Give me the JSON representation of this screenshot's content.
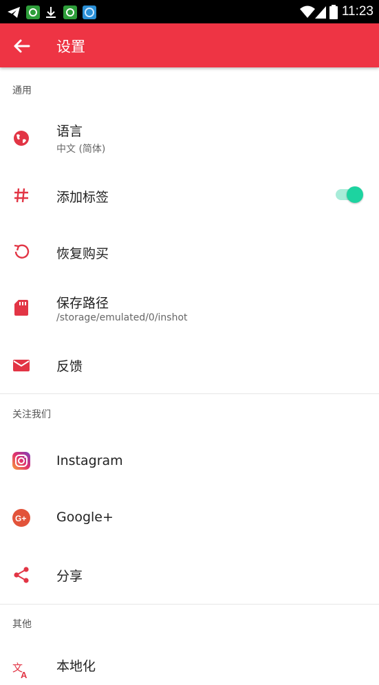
{
  "status_bar": {
    "time": "11:23",
    "icons": [
      "telegram-icon",
      "app-sync-icon",
      "download-icon",
      "app-sync-icon",
      "app-globe-icon",
      "wifi-icon",
      "signal-icon",
      "battery-icon"
    ]
  },
  "app_bar": {
    "title": "设置",
    "back_icon": "arrow-back-icon"
  },
  "sections": {
    "general": {
      "header": "通用",
      "language": {
        "title": "语言",
        "subtitle": "中文 (简体)",
        "icon": "globe-icon"
      },
      "add_tags": {
        "title": "添加标签",
        "icon": "hash-icon",
        "toggle_on": true
      },
      "restore": {
        "title": "恢复购买",
        "icon": "restore-icon"
      },
      "save_path": {
        "title": "保存路径",
        "subtitle": "/storage/emulated/0/inshot",
        "icon": "sd-card-icon"
      },
      "feedback": {
        "title": "反馈",
        "icon": "mail-icon"
      }
    },
    "follow": {
      "header": "关注我们",
      "instagram": {
        "title": "Instagram",
        "icon": "instagram-icon"
      },
      "googleplus": {
        "title": "Google+",
        "icon": "google-plus-icon"
      },
      "share": {
        "title": "分享",
        "icon": "share-icon"
      }
    },
    "other": {
      "header": "其他",
      "localization": {
        "title": "本地化",
        "icon": "translate-icon"
      }
    }
  },
  "colors": {
    "accent": "#ee3444",
    "toggle_on": "#1dd3a0",
    "statusbar": "#000000"
  }
}
